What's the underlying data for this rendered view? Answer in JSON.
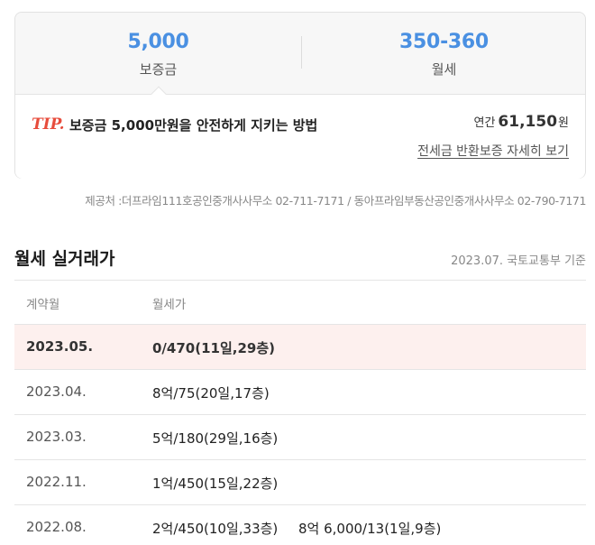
{
  "summary": {
    "deposit_value": "5,000",
    "deposit_label": "보증금",
    "rent_value": "350-360",
    "rent_label": "월세",
    "price_color": "#4a90e2"
  },
  "tip": {
    "tag": "TIP.",
    "text": "보증금 5,000만원을 안전하게 지키는 방법",
    "annual_prefix": "연간",
    "annual_value": "61,150",
    "annual_unit": "원",
    "link": "전세금 반환보증 자세히 보기"
  },
  "provider": "제공처 :더프라임111호공인중개사사무소 02-711-7171 / 동아프라임부동산공인중개사사무소 02-790-7171",
  "section": {
    "title": "월세 실거래가",
    "basis": "2023.07. 국토교통부 기준"
  },
  "table": {
    "headers": [
      "계약월",
      "월세가"
    ],
    "rows": [
      {
        "date": "2023.05.",
        "v1": "0/470(11일,29층)",
        "v2": "",
        "highlight": true
      },
      {
        "date": "2023.04.",
        "v1": "8억/75(20일,17층)",
        "v2": ""
      },
      {
        "date": "2023.03.",
        "v1": "5억/180(29일,16층)",
        "v2": ""
      },
      {
        "date": "2022.11.",
        "v1": "1억/450(15일,22층)",
        "v2": ""
      },
      {
        "date": "2022.08.",
        "v1": "2억/450(10일,33층)",
        "v2": "8억 6,000/13(1일,9층)"
      }
    ]
  }
}
